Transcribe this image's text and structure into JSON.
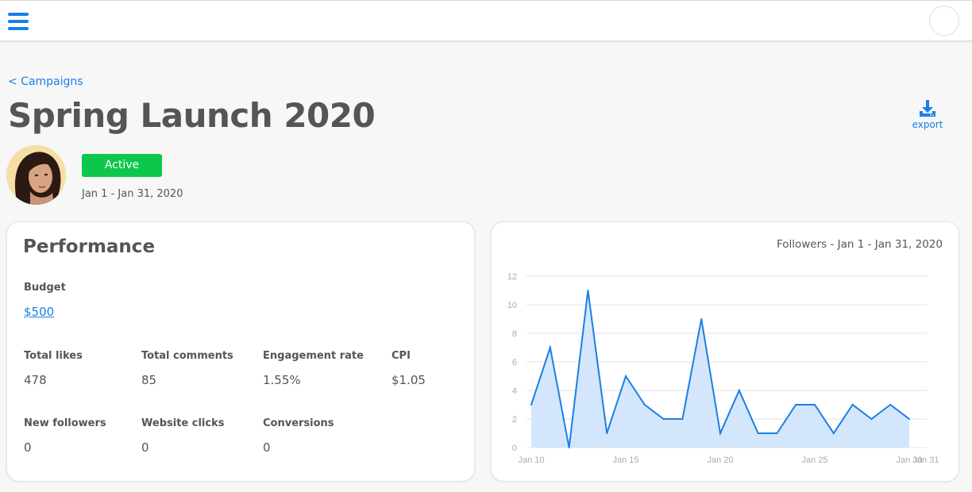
{
  "topbar": {
    "menu_icon": "hamburger-menu-icon",
    "profile_icon": "profile-circle"
  },
  "breadcrumb": {
    "label": "< Campaigns"
  },
  "campaign": {
    "title": "Spring Launch 2020",
    "status": "Active",
    "date_range": "Jan 1 - Jan 31, 2020"
  },
  "export": {
    "label": "export",
    "icon": "download-icon"
  },
  "colors": {
    "accent": "#1a7fe6",
    "status_active": "#0dc74d",
    "chart_fill": "#d4e6fb",
    "chart_line": "#1a7fe6"
  },
  "performance": {
    "title": "Performance",
    "budget_label": "Budget",
    "budget_value": "$500",
    "metrics": [
      {
        "label": "Total likes",
        "value": "478"
      },
      {
        "label": "Total comments",
        "value": "85"
      },
      {
        "label": "Engagement rate",
        "value": "1.55%"
      },
      {
        "label": "CPI",
        "value": "$1.05"
      },
      {
        "label": "New followers",
        "value": "0"
      },
      {
        "label": "Website clicks",
        "value": "0"
      },
      {
        "label": "Conversions",
        "value": "0"
      }
    ]
  },
  "chart_data": {
    "type": "area",
    "title": "Followers - Jan 1 - Jan 31, 2020",
    "x": [
      10,
      11,
      12,
      13,
      14,
      15,
      16,
      17,
      18,
      19,
      20,
      21,
      22,
      23,
      24,
      25,
      26,
      27,
      28,
      29,
      30
    ],
    "values": [
      3,
      7,
      0,
      11,
      1,
      5,
      3,
      2,
      2,
      9,
      1,
      4,
      1,
      1,
      3,
      3,
      1,
      3,
      2,
      3,
      2
    ],
    "x_tick_labels": [
      "Jan 10",
      "Jan 15",
      "Jan 20",
      "Jan 25",
      "Jan 30",
      "Jan 31"
    ],
    "x_tick_values": [
      10,
      15,
      20,
      25,
      30,
      31
    ],
    "y_ticks": [
      0,
      2,
      4,
      6,
      8,
      10,
      12
    ],
    "ylim": [
      0,
      12
    ],
    "grid": true,
    "legend": "none"
  }
}
